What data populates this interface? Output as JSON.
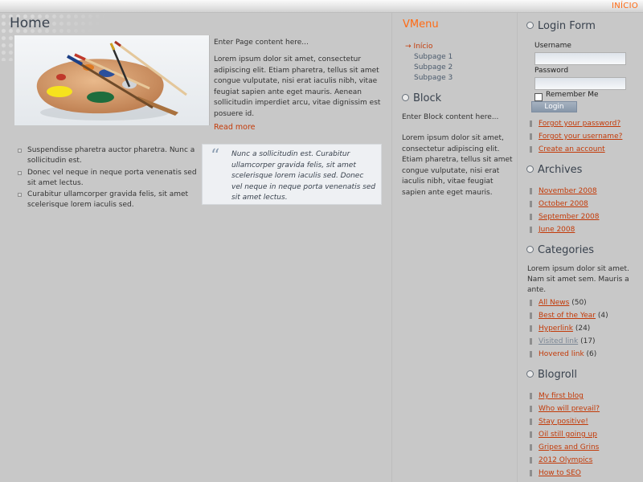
{
  "topnav": {
    "link": "INÍCIO"
  },
  "main": {
    "title": "Home",
    "intro": "Enter Page content here...",
    "paragraph": "Lorem ipsum dolor sit amet, consectetur adipiscing elit. Etiam pharetra, tellus sit amet congue vulputate, nisi erat iaculis nibh, vitae feugiat sapien ante eget mauris. Aenean sollicitudin imperdiet arcu, vitae dignissim est posuere id.",
    "read_more": "Read more",
    "bullets": [
      "Suspendisse pharetra auctor pharetra. Nunc a sollicitudin est.",
      "Donec vel neque in neque porta venenatis sed sit amet lectus.",
      "Curabitur ullamcorper gravida felis, sit amet scelerisque lorem iaculis sed."
    ],
    "quote": "Nunc a sollicitudin est. Curabitur ullamcorper gravida felis, sit amet scelerisque lorem iaculis sed. Donec vel neque in neque porta venenatis sed sit amet lectus."
  },
  "vmenu": {
    "title": "VMenu",
    "items": [
      {
        "label": "Início"
      },
      {
        "label": "Subpage 1"
      },
      {
        "label": "Subpage 2"
      },
      {
        "label": "Subpage 3"
      }
    ]
  },
  "block": {
    "title": "Block",
    "intro": "Enter Block content here...",
    "text": "Lorem ipsum dolor sit amet, consectetur adipiscing elit. Etiam pharetra, tellus sit amet congue vulputate, nisi erat iaculis nibh, vitae feugiat sapien ante eget mauris."
  },
  "login": {
    "title": "Login Form",
    "username_label": "Username",
    "password_label": "Password",
    "username_value": "",
    "password_value": "",
    "remember": "Remember Me",
    "button": "Login",
    "links": [
      "Forgot your password?",
      "Forgot your username?",
      "Create an account"
    ]
  },
  "archives": {
    "title": "Archives",
    "items": [
      "November 2008",
      "October 2008",
      "September 2008",
      "June 2008"
    ]
  },
  "categories": {
    "title": "Categories",
    "text": "Lorem ipsum dolor sit amet. Nam sit amet sem. Mauris a ante.",
    "items": [
      {
        "label": "All News",
        "count": "(50)"
      },
      {
        "label": "Best of the Year",
        "count": "(4)"
      },
      {
        "label": "Hyperlink",
        "count": "(24)"
      },
      {
        "label": "Visited link",
        "count": "(17)"
      },
      {
        "label": "Hovered link",
        "count": "(6)"
      }
    ]
  },
  "blogroll": {
    "title": "Blogroll",
    "items": [
      "My first blog",
      "Who will prevail?",
      "Stay positive!",
      "Oil still going up",
      "Gripes and Grins",
      "2012 Olympics",
      "How to SEO"
    ]
  },
  "colors": {
    "accent": "#ff6a13",
    "link": "#c33a08",
    "heading": "#39424e",
    "background": "#c8c8c8"
  }
}
